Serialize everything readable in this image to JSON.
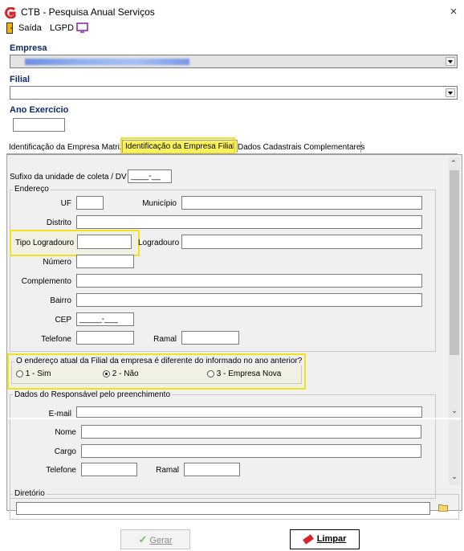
{
  "window": {
    "title": "CTB - Pesquisa Anual Serviços",
    "close": "×"
  },
  "toolbar": {
    "exit_label": "Saída",
    "lgpd_label": "LGPD"
  },
  "empresa": {
    "label": "Empresa"
  },
  "filial": {
    "label": "Filial"
  },
  "ano": {
    "label": "Ano Exercício",
    "value": ""
  },
  "tabs": [
    {
      "label": "Identificação da Empresa Matriz"
    },
    {
      "label": "Identificação da Empresa Filial"
    },
    {
      "label": "Dados Cadastrais Complementares"
    }
  ],
  "form": {
    "sufixo_label": "Sufixo da unidade de coleta / DV",
    "sufixo_mask": "____-__",
    "endereco_title": "Endereço",
    "uf_label": "UF",
    "municipio_label": "Município",
    "distrito_label": "Distrito",
    "tipo_logradouro_label": "Tipo Logradouro",
    "logradouro_label": "Logradouro",
    "numero_label": "Número",
    "complemento_label": "Complemento",
    "bairro_label": "Bairro",
    "cep_label": "CEP",
    "cep_mask": "_____-___",
    "telefone_label": "Telefone",
    "ramal_label": "Ramal",
    "question": "O endereço atual da Filial da empresa é diferente do informado no ano anterior?",
    "options": [
      "1 - Sim",
      "2 - Não",
      "3 - Empresa Nova"
    ],
    "selected_option": "2 - Não",
    "resp_title": "Dados do Responsável pelo preenchimento",
    "email_label": "E-mail",
    "nome_label": "Nome",
    "cargo_label": "Cargo",
    "telefone2_label": "Telefone",
    "ramal2_label": "Ramal"
  },
  "diretorio": {
    "title": "Diretório"
  },
  "buttons": {
    "gerar": "Gerar",
    "limpar": "Limpar"
  },
  "colors": {
    "highlight": "#f2e21d",
    "label_blue": "#0a2a6b"
  }
}
